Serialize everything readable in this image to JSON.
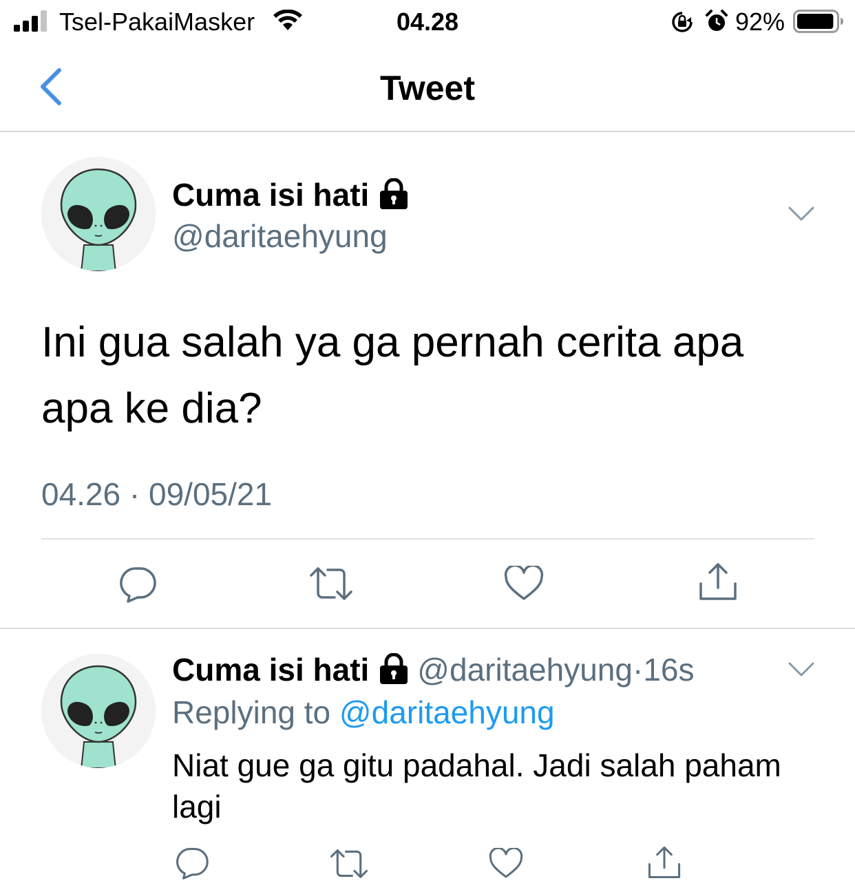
{
  "status_bar": {
    "carrier": "Tsel-PakaiMasker",
    "time": "04.28",
    "battery_percent": "92%",
    "battery_level": 0.92,
    "icons": [
      "signal-icon",
      "wifi-icon",
      "rotation-lock-icon",
      "alarm-icon",
      "battery-icon"
    ]
  },
  "nav": {
    "title": "Tweet",
    "back_icon": "chevron-left-icon"
  },
  "main_tweet": {
    "display_name": "Cuma isi hati",
    "handle": "@daritaehyung",
    "text": "Ini gua salah ya ga pernah cerita apa apa ke dia?",
    "meta": "04.26 · 09/05/21",
    "protected_icon": "lock-icon",
    "actions": [
      "reply-icon",
      "retweet-icon",
      "like-icon",
      "share-icon"
    ]
  },
  "reply_tweet": {
    "display_name": "Cuma isi hati",
    "handle": "@daritaehyung",
    "separator": "·",
    "time_ago": "16s",
    "replying_prefix": "Replying to",
    "replying_to": "@daritaehyung",
    "text": "Niat gue ga gitu padahal. Jadi salah paham lagi",
    "actions": [
      "reply-icon",
      "retweet-icon",
      "like-icon",
      "share-icon"
    ]
  },
  "colors": {
    "accent": "#1d9bf0",
    "back_arrow": "#4a90e2",
    "secondary_text": "#5b6f7f",
    "icon_gray": "#5b6f7f",
    "avatar_alien": "#9fe2cd"
  }
}
